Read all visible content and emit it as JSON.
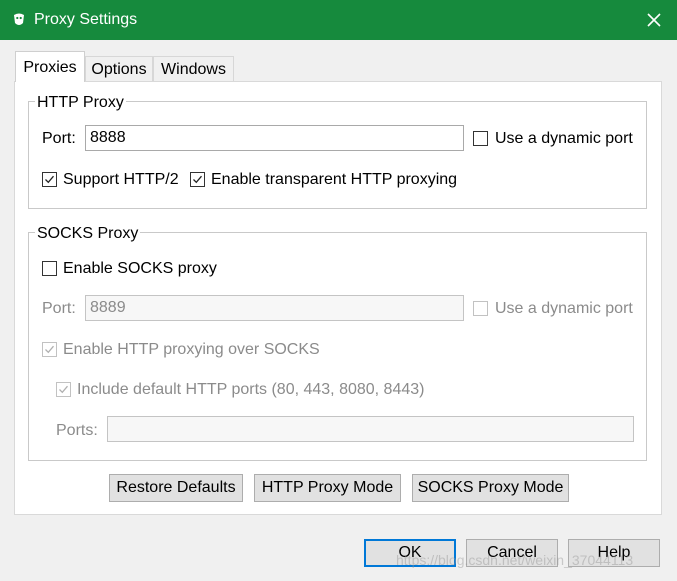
{
  "window": {
    "title": "Proxy Settings",
    "icon": "fiddler-app-icon",
    "close_icon": "close-icon",
    "titlebar_color": "#168a3d"
  },
  "tabs": [
    {
      "label": "Proxies",
      "active": true
    },
    {
      "label": "Options",
      "active": false
    },
    {
      "label": "Windows",
      "active": false
    }
  ],
  "http_proxy": {
    "legend": "HTTP Proxy",
    "port_label": "Port:",
    "port_value": "8888",
    "dynamic_port_label": "Use a dynamic port",
    "dynamic_port_checked": false,
    "support_http2_label": "Support HTTP/2",
    "support_http2_checked": true,
    "transparent_label": "Enable transparent HTTP proxying",
    "transparent_checked": true
  },
  "socks_proxy": {
    "legend": "SOCKS Proxy",
    "enable_label": "Enable SOCKS proxy",
    "enable_checked": false,
    "port_label": "Port:",
    "port_value": "8889",
    "dynamic_port_label": "Use a dynamic port",
    "dynamic_port_checked": false,
    "http_over_socks_label": "Enable HTTP proxying over SOCKS",
    "http_over_socks_checked": true,
    "include_ports_label": "Include default HTTP ports (80, 443, 8080, 8443)",
    "include_ports_checked": true,
    "ports_label": "Ports:",
    "ports_value": ""
  },
  "mode_buttons": {
    "restore": "Restore Defaults",
    "http_mode": "HTTP Proxy Mode",
    "socks_mode": "SOCKS Proxy Mode"
  },
  "footer": {
    "ok": "OK",
    "cancel": "Cancel",
    "help": "Help"
  },
  "watermark": "https://blog.csdn.net/weixin_37044113"
}
